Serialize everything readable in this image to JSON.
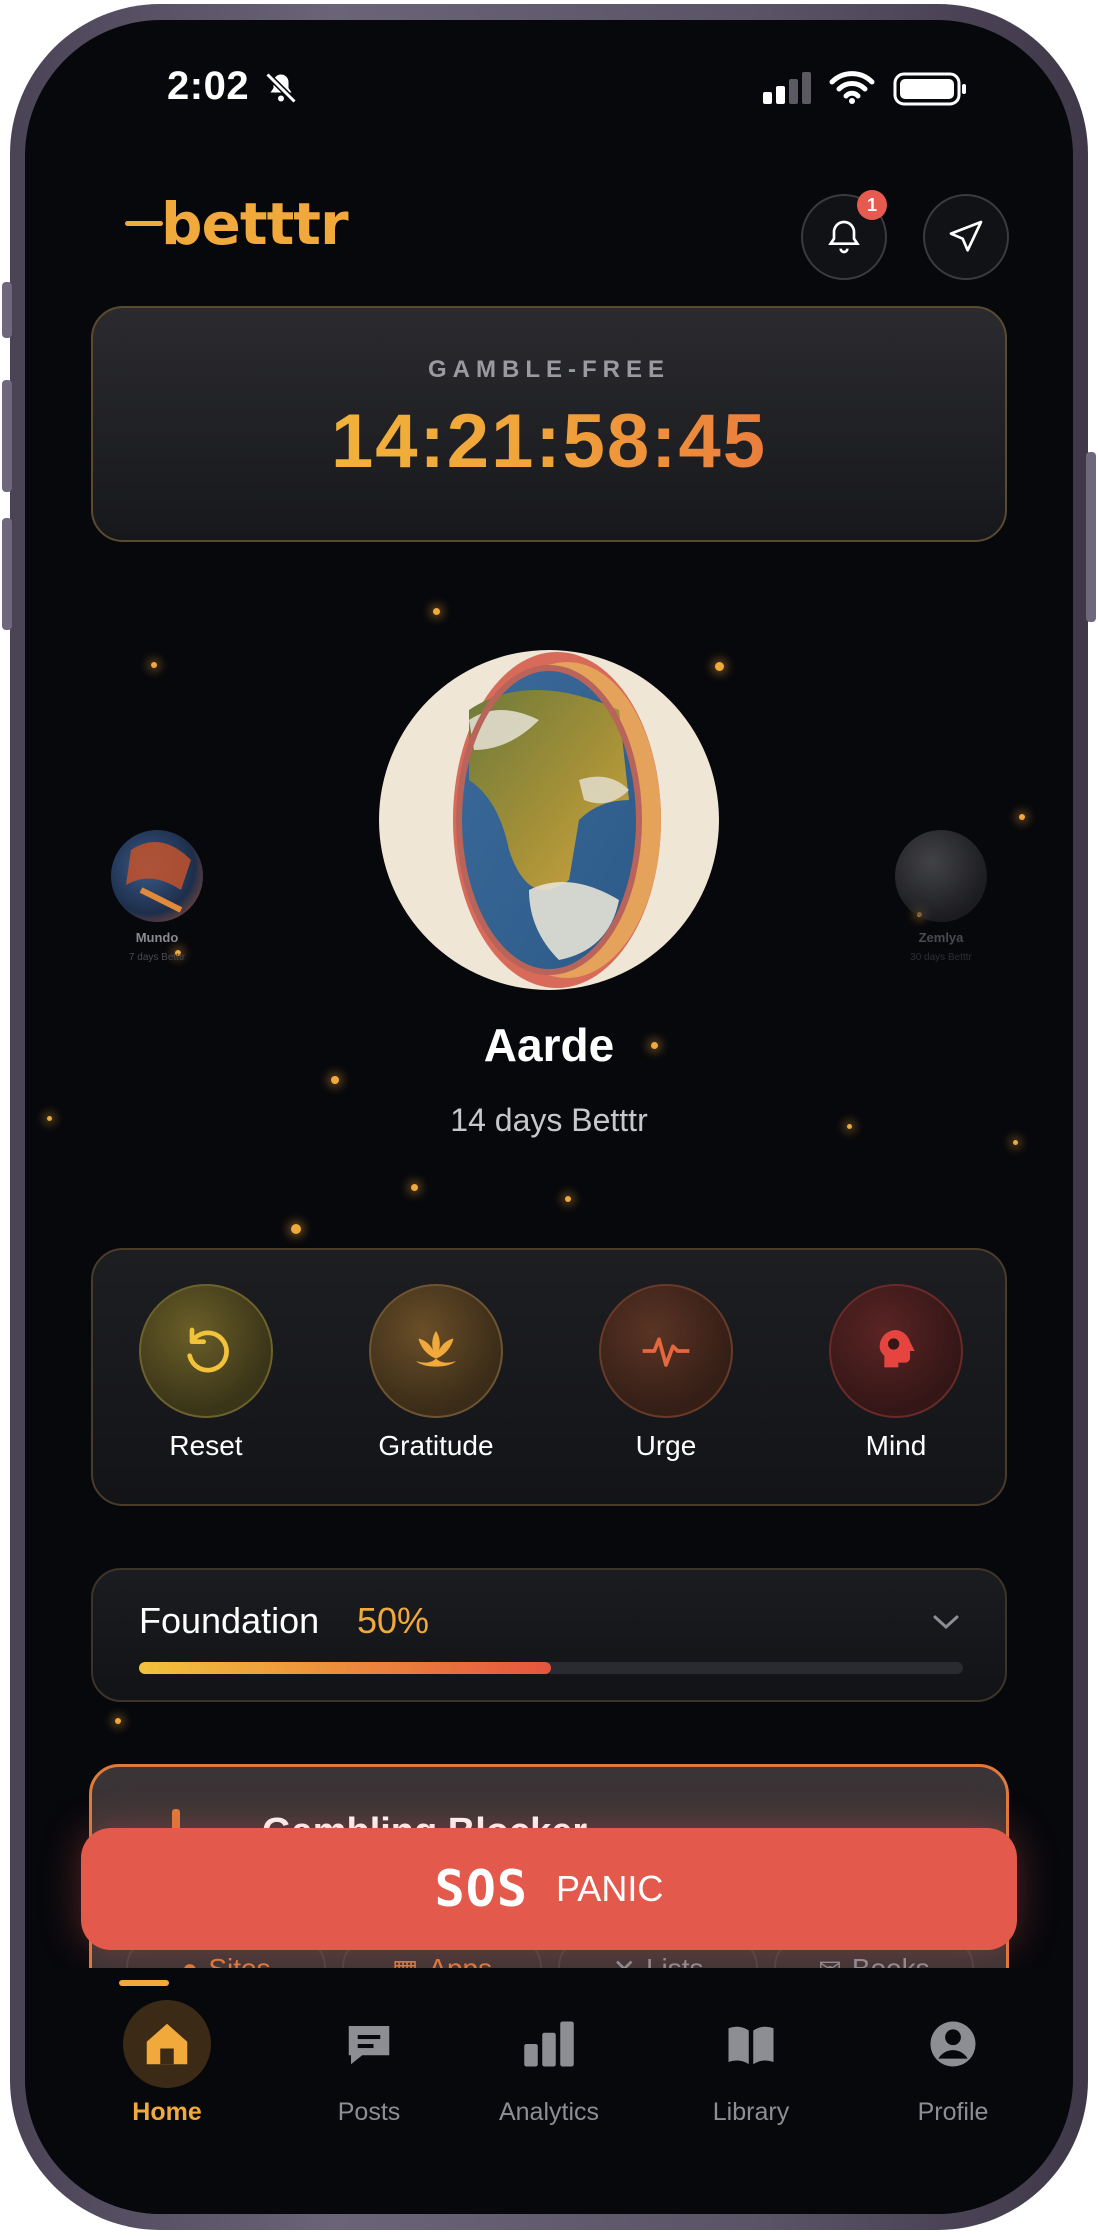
{
  "status_bar": {
    "time": "2:02"
  },
  "header": {
    "logo_text": "betttr",
    "notification_count": "1"
  },
  "timer": {
    "label": "GAMBLE-FREE",
    "value": "14:21:58:45"
  },
  "planets": {
    "left": {
      "name": "Mundo",
      "sub": "7 days Betttr"
    },
    "main": {
      "name": "Aarde",
      "days": "14 days Betttr"
    },
    "right": {
      "name": "Zemlya",
      "sub": "30 days Betttr"
    }
  },
  "actions": [
    {
      "label": "Reset",
      "icon": "reset-icon",
      "color": "#f2c23b"
    },
    {
      "label": "Gratitude",
      "icon": "lotus-icon",
      "color": "#f2a93b"
    },
    {
      "label": "Urge",
      "icon": "pulse-icon",
      "color": "#e5673e"
    },
    {
      "label": "Mind",
      "icon": "brain-icon",
      "color": "#e5453e"
    }
  ],
  "foundation": {
    "title": "Foundation",
    "percent_label": "50%",
    "progress": 0.5
  },
  "blocker": {
    "title": "Gambling Blocker",
    "chips": [
      "Sites",
      "Apps",
      "Lists",
      "Books"
    ]
  },
  "sos": {
    "label_a": "SOS",
    "label_b": "PANIC"
  },
  "nav": [
    {
      "label": "Home",
      "icon": "home-icon",
      "active": true
    },
    {
      "label": "Posts",
      "icon": "chat-icon",
      "active": false
    },
    {
      "label": "Analytics",
      "icon": "bar-chart-icon",
      "active": false
    },
    {
      "label": "Library",
      "icon": "book-icon",
      "active": false
    },
    {
      "label": "Profile",
      "icon": "user-icon",
      "active": false
    }
  ],
  "colors": {
    "accent": "#f2a93b",
    "sos": "#e35a4c",
    "background": "#07080c"
  }
}
